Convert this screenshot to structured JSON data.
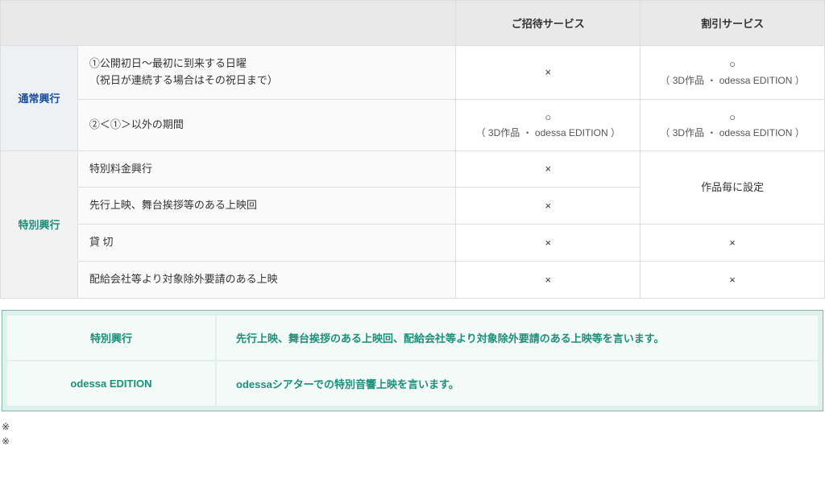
{
  "table": {
    "header_col1": "ご招待サービス",
    "header_col2": "割引サービス",
    "group_normal": "通常興行",
    "group_special": "特別興行",
    "normal_row1_label_line1": "①公開初日～最初に到来する日曜",
    "normal_row1_label_line2": "（祝日が連続する場合はその祝日まで）",
    "normal_row1_col1": "×",
    "normal_row1_col2_mark": "○",
    "normal_row1_col2_note": "（ 3D作品 ・ odessa EDITION ）",
    "normal_row2_label": "②＜①＞以外の期間",
    "normal_row2_col1_mark": "○",
    "normal_row2_col1_note": "（ 3D作品 ・ odessa EDITION ）",
    "normal_row2_col2_mark": "○",
    "normal_row2_col2_note": "（ 3D作品 ・ odessa EDITION ）",
    "special_row1_label": "特別料金興行",
    "special_row1_col1": "×",
    "special_row12_col2": "作品毎に設定",
    "special_row2_label": "先行上映、舞台挨拶等のある上映回",
    "special_row2_col1": "×",
    "special_row3_label": "貸  切",
    "special_row3_col1": "×",
    "special_row3_col2": "×",
    "special_row4_label": "配給会社等より対象除外要請のある上映",
    "special_row4_col1": "×",
    "special_row4_col2": "×"
  },
  "defs": {
    "term1": "特別興行",
    "def1": "先行上映、舞台挨拶のある上映回、配給会社等より対象除外要請のある上映等を言います。",
    "term2": "odessa EDITION",
    "def2": "odessaシアターでの特別音響上映を言います。"
  },
  "footnotes": {
    "f1": "※",
    "f2": "※"
  }
}
